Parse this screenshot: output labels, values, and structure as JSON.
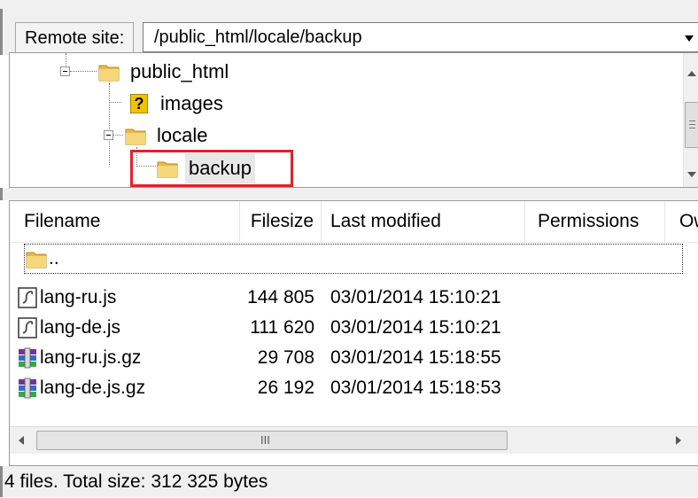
{
  "remote_site": {
    "label": "Remote site:",
    "path": "/public_html/locale/backup"
  },
  "tree": {
    "nodes": [
      {
        "label": "public_html",
        "icon": "folder-icon",
        "expanded": true
      },
      {
        "label": "images",
        "icon": "unknown-folder-icon"
      },
      {
        "label": "locale",
        "icon": "folder-icon",
        "expanded": true
      },
      {
        "label": "backup",
        "icon": "folder-icon",
        "selected": true
      }
    ],
    "highlight_color": "#e0232c"
  },
  "file_list": {
    "columns": [
      "Filename",
      "Filesize",
      "Last modified",
      "Permissions",
      "Ow"
    ],
    "parent_dir": "..",
    "rows": [
      {
        "name": "lang-ru.js",
        "size": "144 805",
        "modified": "03/01/2014 15:10:21",
        "icon": "script-file-icon"
      },
      {
        "name": "lang-de.js",
        "size": "111 620",
        "modified": "03/01/2014 15:10:21",
        "icon": "script-file-icon"
      },
      {
        "name": "lang-ru.js.gz",
        "size": "29 708",
        "modified": "03/01/2014 15:18:55",
        "icon": "archive-file-icon"
      },
      {
        "name": "lang-de.js.gz",
        "size": "26 192",
        "modified": "03/01/2014 15:18:53",
        "icon": "archive-file-icon"
      }
    ],
    "scrollbar_glyph": "III"
  },
  "status": {
    "text": "4 files. Total size: 312 325 bytes"
  }
}
